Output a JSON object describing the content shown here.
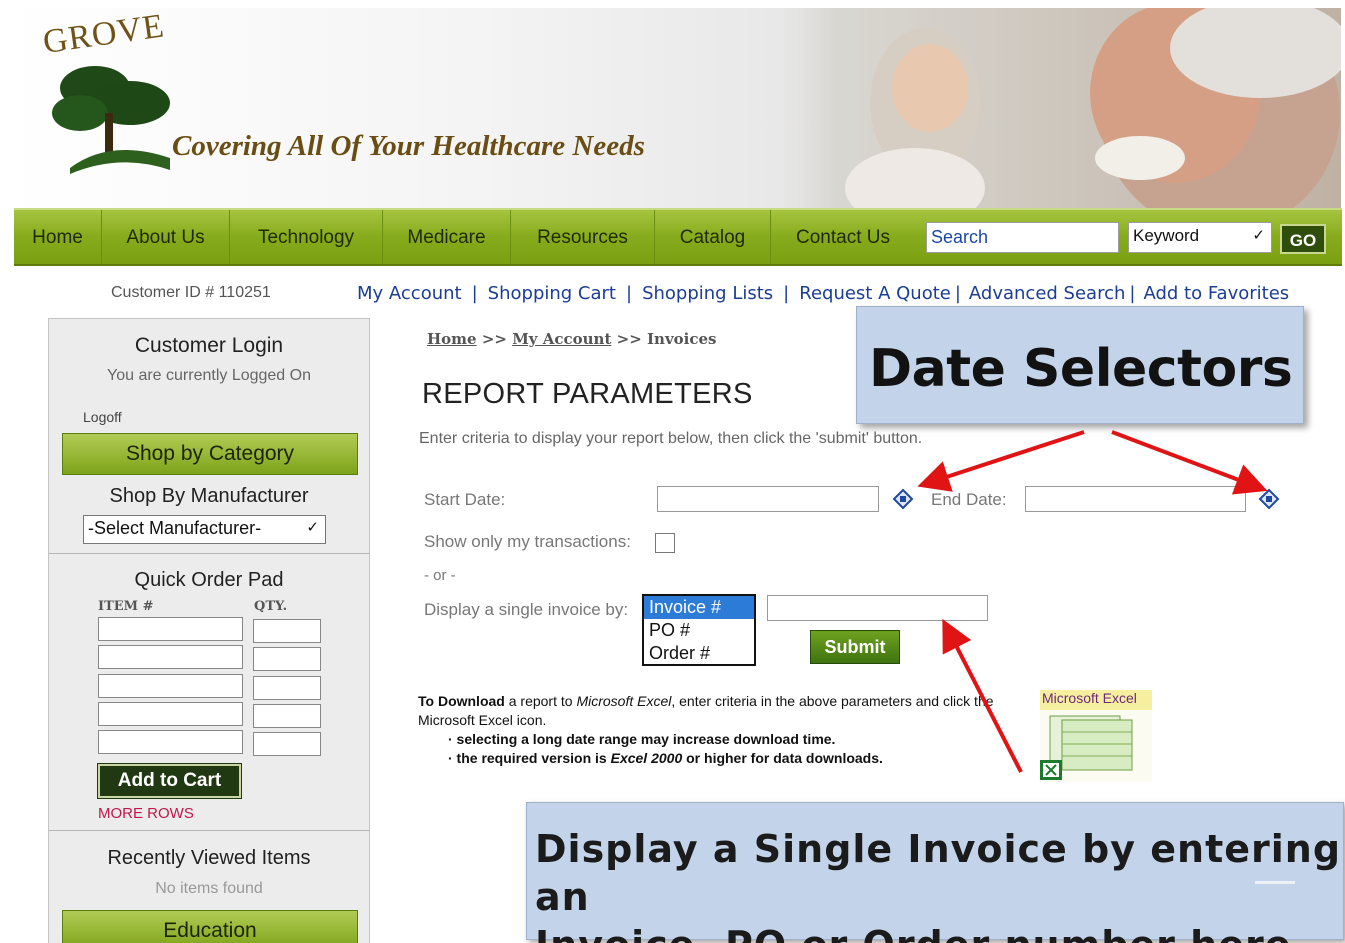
{
  "header": {
    "logo_word": "GROVE",
    "tagline": "Covering All Of Your Healthcare Needs"
  },
  "nav": {
    "items": [
      "Home",
      "About Us",
      "Technology",
      "Medicare",
      "Resources",
      "Catalog",
      "Contact Us"
    ],
    "search_placeholder": "Search",
    "search_type": "Keyword",
    "go_label": "GO"
  },
  "topbar": {
    "customer_id": "Customer ID # 110251",
    "links": [
      "My Account",
      "Shopping Cart",
      "Shopping Lists",
      "Request A Quote",
      "Advanced Search",
      "Add to Favorites"
    ]
  },
  "sidebar": {
    "login_title": "Customer Login",
    "login_status": "You are currently Logged On",
    "logoff": "Logoff",
    "shop_category": "Shop by Category",
    "shop_manufacturer": "Shop By Manufacturer",
    "manufacturer_select": "-Select Manufacturer-",
    "quick_order_title": "Quick Order Pad",
    "item_header": "ITEM #",
    "qty_header": "QTY.",
    "add_to_cart": "Add to Cart",
    "more_rows": "MORE ROWS",
    "recent_title": "Recently Viewed Items",
    "recent_empty": "No items found",
    "education": "Education"
  },
  "breadcrumb": {
    "home": "Home",
    "sep": ">>",
    "account": "My Account",
    "current": "Invoices"
  },
  "report": {
    "title": "REPORT PARAMETERS",
    "description": "Enter criteria to display your report below, then click the 'submit' button.",
    "start_date_label": "Start Date:",
    "end_date_label": "End Date:",
    "show_only_label": "Show only my transactions:",
    "or_label": "- or -",
    "single_invoice_label": "Display a single invoice by:",
    "invoice_options": [
      "Invoice #",
      "PO #",
      "Order #"
    ],
    "submit_label": "Submit",
    "download_bold": "To Download",
    "download_text_1": " a report to ",
    "download_excel": "Microsoft Excel",
    "download_text_2": ", enter criteria in the above parameters and click the Microsoft Excel icon.",
    "bullet_1": "· selecting a long date range may increase download time.",
    "bullet_2_pre": "· the required version is ",
    "bullet_2_em": "Excel 2000",
    "bullet_2_post": " or higher for data downloads.",
    "excel_label": "Microsoft Excel"
  },
  "callouts": {
    "date": "Date Selectors",
    "invoice_line1": "Display a Single Invoice by entering an",
    "invoice_line2": "Invoice, PO or Order number here."
  },
  "colors": {
    "nav_green": "#86ab1c",
    "link_blue": "#1b3d94",
    "callout_blue": "#c3d4ea",
    "arrow_red": "#e01414"
  }
}
